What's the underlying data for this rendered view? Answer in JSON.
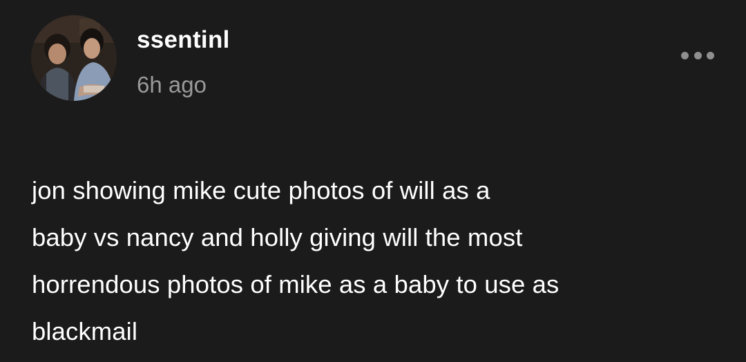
{
  "post": {
    "author": {
      "username": "ssentinl",
      "timestamp": "6h ago",
      "avatar_icon": "avatar-photo"
    },
    "more_button_icon": "more-dots-icon",
    "body_lines": [
      "jon showing mike cute photos of will as a",
      "baby vs nancy and holly giving will the most",
      "horrendous photos of mike as a baby to use as",
      "blackmail"
    ]
  },
  "colors": {
    "background": "#1b1b1b",
    "text": "#ffffff",
    "muted": "#9a9a9a",
    "icon": "#8f8f8f"
  }
}
